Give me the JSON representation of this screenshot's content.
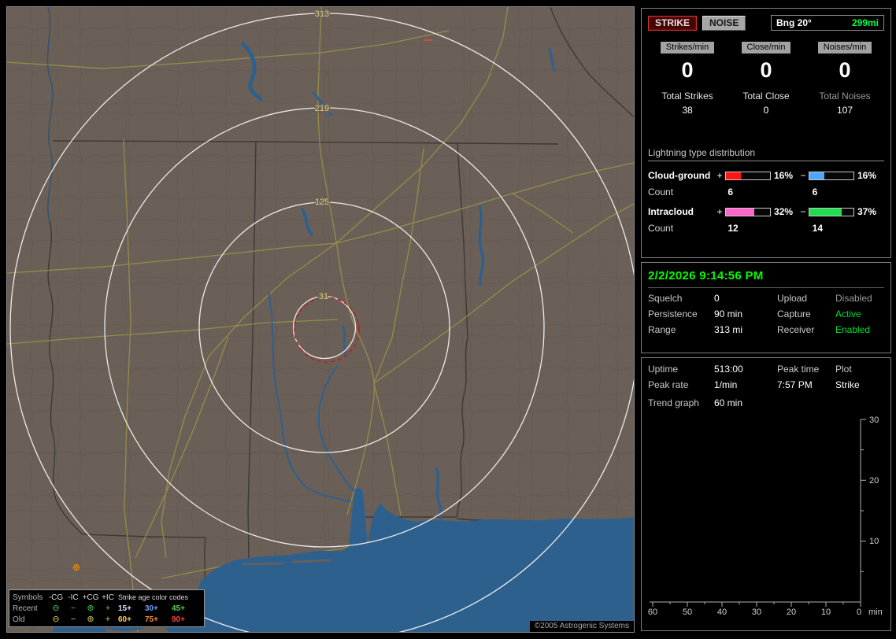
{
  "map": {
    "ring_labels": {
      "r1": "313",
      "r2": "219",
      "r3": "125",
      "r4": "31"
    },
    "copyright": "©2005 Astrogenic Systems",
    "legend": {
      "symbols_title": "Symbols",
      "col_ncg": "-CG",
      "col_nic": "-IC",
      "col_pcg": "+CG",
      "col_pic": "+IC",
      "age_title": "Strike age color codes",
      "recent_label": "Recent",
      "old_label": "Old",
      "symbols": {
        "ncg": "⊖",
        "nic": "−",
        "pcg": "⊕",
        "pic": "+"
      },
      "recent_symbol_color": "#3fcc55",
      "old_symbol_color": "#cfcf4a",
      "recent_ages": {
        "a1": "15+",
        "a2": "30+",
        "a3": "45+"
      },
      "old_ages": {
        "a1": "60+",
        "a2": "75+",
        "a3": "90+"
      },
      "age_colors": {
        "a15": "#cfe0ff",
        "a30": "#6f9fff",
        "a45": "#54d754",
        "a60": "#ffd24d",
        "a75": "#ff8c3a",
        "a90": "#ff4545"
      }
    }
  },
  "header": {
    "strike_button": "STRIKE",
    "noise_button": "NOISE",
    "bearing": "Bng 20°",
    "bearing_range": "299mi"
  },
  "rates": {
    "strikes": {
      "badge": "Strikes/min",
      "value": "0",
      "total_label": "Total Strikes",
      "total": "38"
    },
    "close": {
      "badge": "Close/min",
      "value": "0",
      "total_label": "Total Close",
      "total": "0"
    },
    "noises": {
      "badge": "Noises/min",
      "value": "0",
      "total_label": "Total Noises",
      "total": "107"
    }
  },
  "distribution": {
    "title": "Lightning type distribution",
    "cloud_ground": {
      "name": "Cloud-ground",
      "plus_sign": "+",
      "minus_sign": "−",
      "plus_pct": "16%",
      "minus_pct": "16%",
      "plus_fill": 34,
      "minus_fill": 34,
      "plus_color": "#ff1515",
      "minus_color": "#4da6ff",
      "count_label": "Count",
      "plus_count": "6",
      "minus_count": "6"
    },
    "intracloud": {
      "name": "Intracloud",
      "plus_sign": "+",
      "minus_sign": "−",
      "plus_pct": "32%",
      "minus_pct": "37%",
      "plus_fill": 64,
      "minus_fill": 74,
      "plus_color": "#ff66cc",
      "minus_color": "#1edd4e",
      "count_label": "Count",
      "plus_count": "12",
      "minus_count": "14"
    }
  },
  "status": {
    "datetime": "2/2/2026 9:14:56 PM",
    "squelch_label": "Squelch",
    "squelch": "0",
    "upload_label": "Upload",
    "upload": "Disabled",
    "upload_color": "#9a9a9a",
    "persistence_label": "Persistence",
    "persistence": "90 min",
    "capture_label": "Capture",
    "capture": "Active",
    "capture_color": "#00dd33",
    "range_label": "Range",
    "range": "313 mi",
    "receiver_label": "Receiver",
    "receiver": "Enabled",
    "receiver_color": "#00dd33"
  },
  "stats": {
    "uptime_label": "Uptime",
    "uptime": "513:00",
    "peak_time_label": "Peak time",
    "peak_time": "7:57 PM",
    "plot_label": "Plot",
    "plot": "Strike",
    "peak_rate_label": "Peak rate",
    "peak_rate": "1/min",
    "trend_label": "Trend graph",
    "trend_value": "60 min"
  },
  "trend_chart": {
    "y_ticks": {
      "t30": "30",
      "t20": "20",
      "t10": "10"
    },
    "x_ticks": {
      "t60": "60",
      "t50": "50",
      "t40": "40",
      "t30": "30",
      "t20": "20",
      "t10": "10",
      "t0": "0"
    },
    "unit": "min"
  },
  "colors": {
    "accent_green": "#00ff00",
    "range_green": "#00ff44"
  }
}
